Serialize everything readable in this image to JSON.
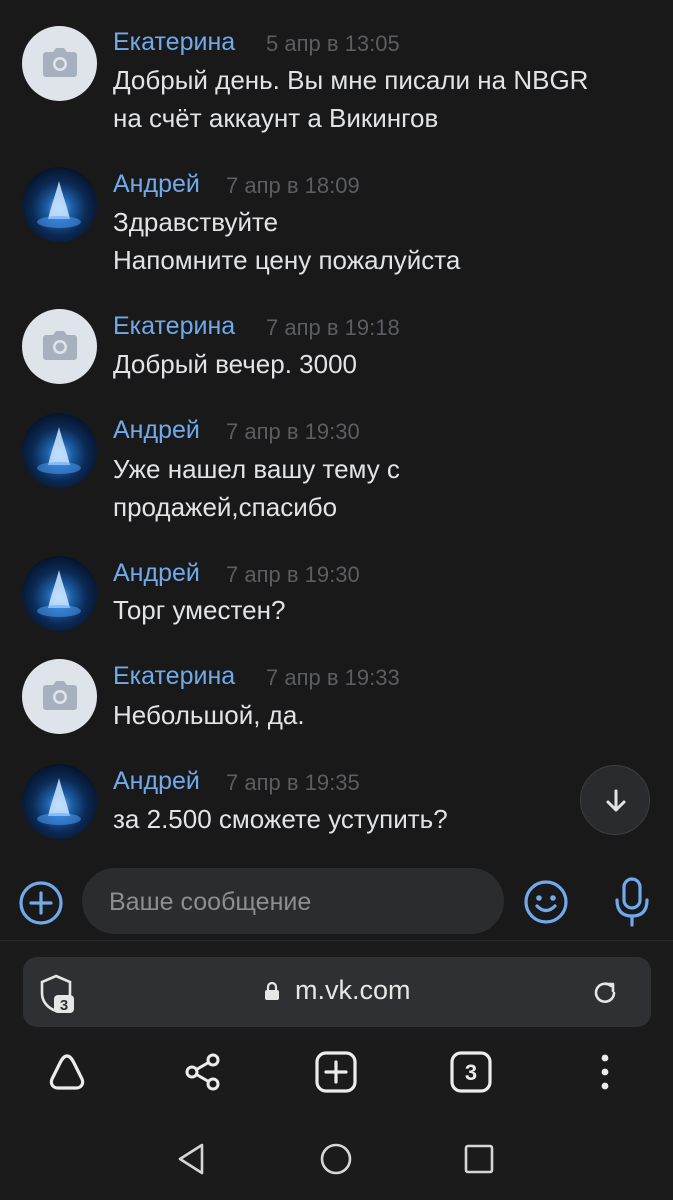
{
  "messages": [
    {
      "author": "Екатерина",
      "time": "5 апр в 13:05",
      "avatar": "camera-placeholder",
      "lines": [
        "Добрый день. Вы мне писали на NBGR",
        "на счёт аккаунт а Викингов"
      ]
    },
    {
      "author": "Андрей",
      "time": "7 апр в 18:09",
      "avatar": "photo",
      "lines": [
        "Здравствуйте",
        "Напомните цену пожалуйста"
      ]
    },
    {
      "author": "Екатерина",
      "time": "7 апр в 19:18",
      "avatar": "camera-placeholder",
      "lines": [
        "Добрый вечер. 3000"
      ]
    },
    {
      "author": "Андрей",
      "time": "7 апр в 19:30",
      "avatar": "photo",
      "lines": [
        "Уже нашел вашу тему с",
        "продажей,спасибо"
      ]
    },
    {
      "author": "Андрей",
      "time": "7 апр в 19:30",
      "avatar": "photo",
      "lines": [
        "Торг уместен?"
      ]
    },
    {
      "author": "Екатерина",
      "time": "7 апр в 19:33",
      "avatar": "camera-placeholder",
      "lines": [
        "Небольшой, да."
      ]
    },
    {
      "author": "Андрей",
      "time": "7 апр в 19:35",
      "avatar": "photo",
      "lines": [
        "за 2.500 сможете уступить?"
      ]
    }
  ],
  "composer": {
    "placeholder": "Ваше сообщение"
  },
  "browser": {
    "url": "m.vk.com",
    "tab_count": "3",
    "shield_count": "3"
  },
  "icons": [
    "scroll-down-arrow-icon",
    "plus-circle-icon",
    "emoji-icon",
    "microphone-icon",
    "shield-icon",
    "lock-icon",
    "reload-icon",
    "browser-home-icon",
    "share-icon",
    "new-tab-icon",
    "tabs-icon",
    "more-icon",
    "back-icon",
    "home-icon",
    "recents-icon"
  ],
  "colors": {
    "accent": "#71aaeb",
    "background": "#19191a",
    "name": "#71aaeb",
    "timestamp": "#5b5d61"
  }
}
